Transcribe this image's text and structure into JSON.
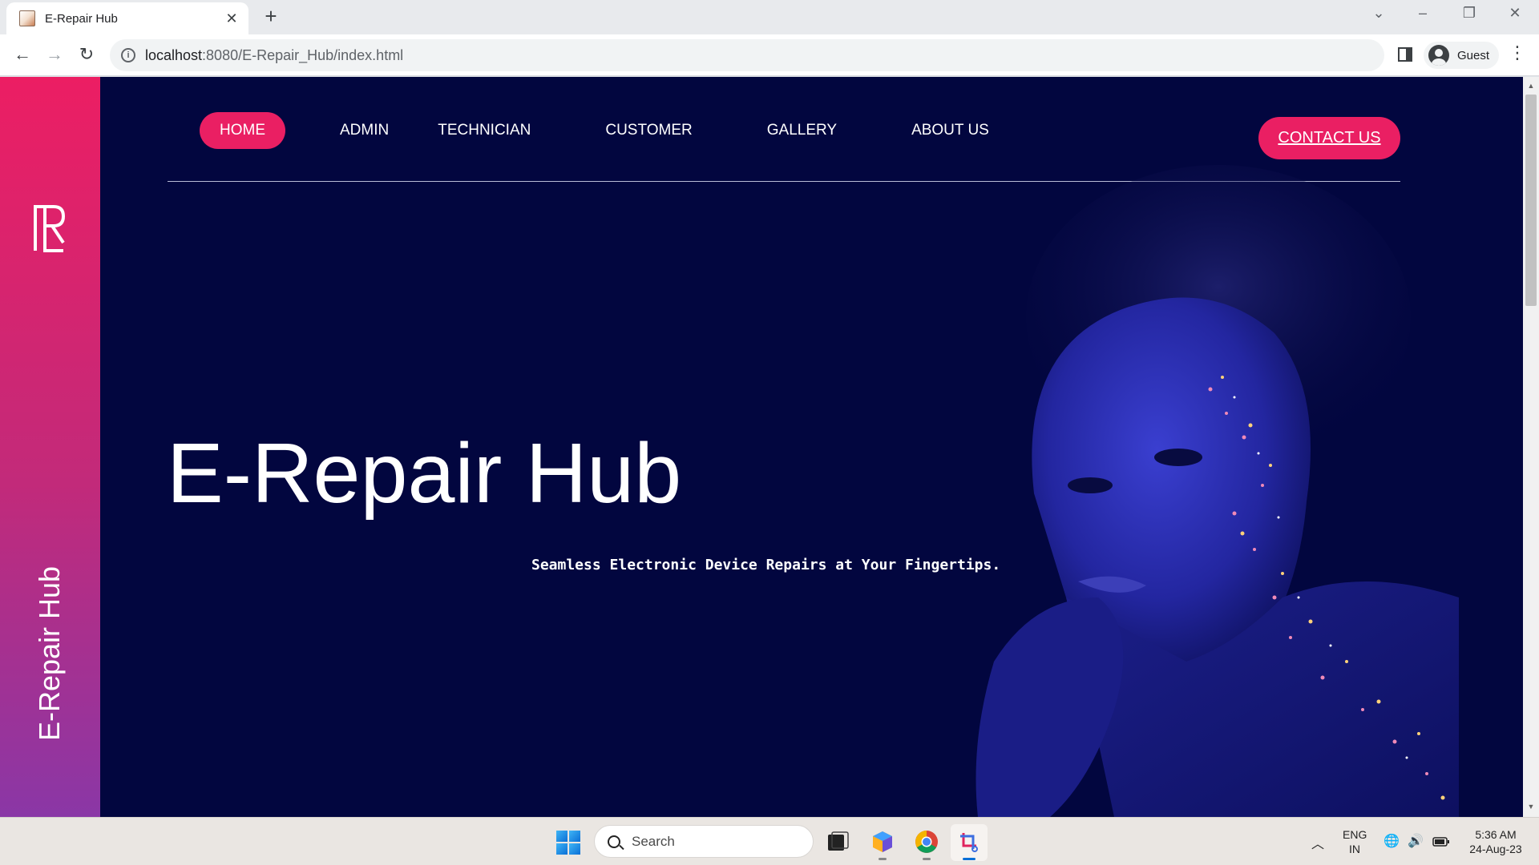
{
  "browser": {
    "tab_title": "E-Repair Hub",
    "url_host": "localhost",
    "url_rest": ":8080/E-Repair_Hub/index.html",
    "profile_name": "Guest"
  },
  "site": {
    "sidebar_title": "E-Repair Hub",
    "nav": [
      "HOME",
      "ADMIN",
      "TECHNICIAN",
      "CUSTOMER",
      "GALLERY",
      "ABOUT US"
    ],
    "contact_label": "CONTACT US",
    "hero_title": "E-Repair Hub",
    "hero_subtitle": "Seamless Electronic Device Repairs at Your Fingertips.",
    "colors": {
      "accent": "#ea1f63",
      "background": "#02063f",
      "sidebar_top": "#ec1e63",
      "sidebar_bottom": "#8a37a6"
    }
  },
  "taskbar": {
    "search_placeholder": "Search",
    "lang_top": "ENG",
    "lang_bottom": "IN",
    "time": "5:36 AM",
    "date": "24-Aug-23"
  }
}
